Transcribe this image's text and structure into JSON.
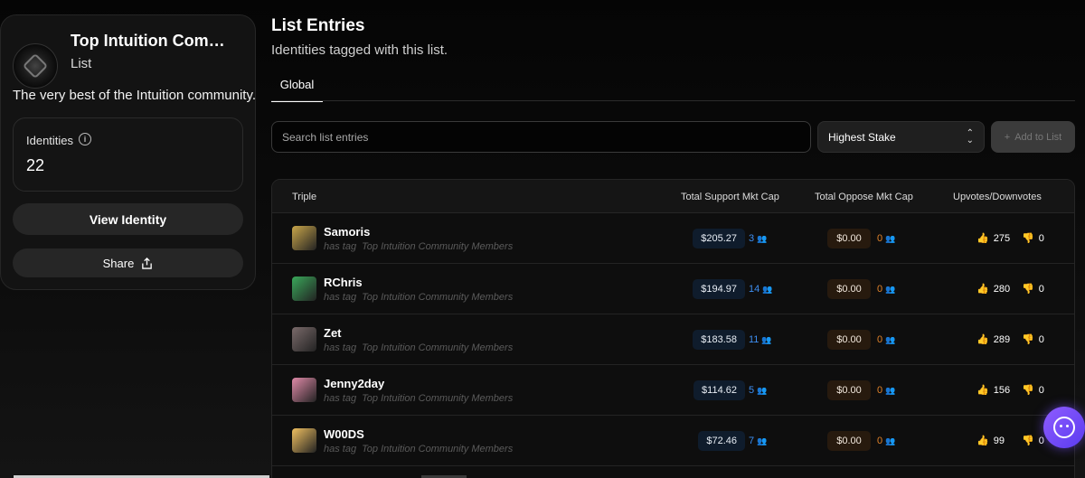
{
  "sidebar": {
    "title": "Top Intuition Com…",
    "subtitle": "List",
    "description": "The very best of the Intuition community.",
    "identities_label": "Identities",
    "identities_count": "22",
    "view_button": "View Identity",
    "share_button": "Share",
    "avatar_icon": "list-logo-icon"
  },
  "main": {
    "title": "List Entries",
    "subtitle": "Identities tagged with this list.",
    "tabs": [
      {
        "label": "Global"
      }
    ],
    "search_placeholder": "Search list entries",
    "sort_value": "Highest Stake",
    "add_button": "Add to List"
  },
  "table": {
    "headers": [
      "Triple",
      "Total Support Mkt Cap",
      "Total Oppose Mkt Cap",
      "Upvotes/Downvotes"
    ],
    "rows": [
      {
        "name": "Samoris",
        "tag_word": "has tag",
        "tag_list": "Top Intuition Community Members",
        "support": "$205.27",
        "support_count": "3",
        "oppose": "$0.00",
        "oppose_count": "0",
        "up": "275",
        "down": "0",
        "avatar_color": "#c9a64a"
      },
      {
        "name": "RChris",
        "tag_word": "has tag",
        "tag_list": "Top Intuition Community Members",
        "support": "$194.97",
        "support_count": "14",
        "oppose": "$0.00",
        "oppose_count": "0",
        "up": "280",
        "down": "0",
        "avatar_color": "#3aa85a"
      },
      {
        "name": "Zet",
        "tag_word": "has tag",
        "tag_list": "Top Intuition Community Members",
        "support": "$183.58",
        "support_count": "11",
        "oppose": "$0.00",
        "oppose_count": "0",
        "up": "289",
        "down": "0",
        "avatar_color": "#7a6a6a"
      },
      {
        "name": "Jenny2day",
        "tag_word": "has tag",
        "tag_list": "Top Intuition Community Members",
        "support": "$114.62",
        "support_count": "5",
        "oppose": "$0.00",
        "oppose_count": "0",
        "up": "156",
        "down": "0",
        "avatar_color": "#e08aa8"
      },
      {
        "name": "W00DS",
        "tag_word": "has tag",
        "tag_list": "Top Intuition Community Members",
        "support": "$72.46",
        "support_count": "7",
        "oppose": "$0.00",
        "oppose_count": "0",
        "up": "99",
        "down": "0",
        "avatar_color": "#f0c060"
      }
    ]
  },
  "colors": {
    "support_accent": "#3e8ef0",
    "oppose_accent": "#e0822a",
    "vote_accent": "#f4b400",
    "fab": "#7a4cff"
  }
}
